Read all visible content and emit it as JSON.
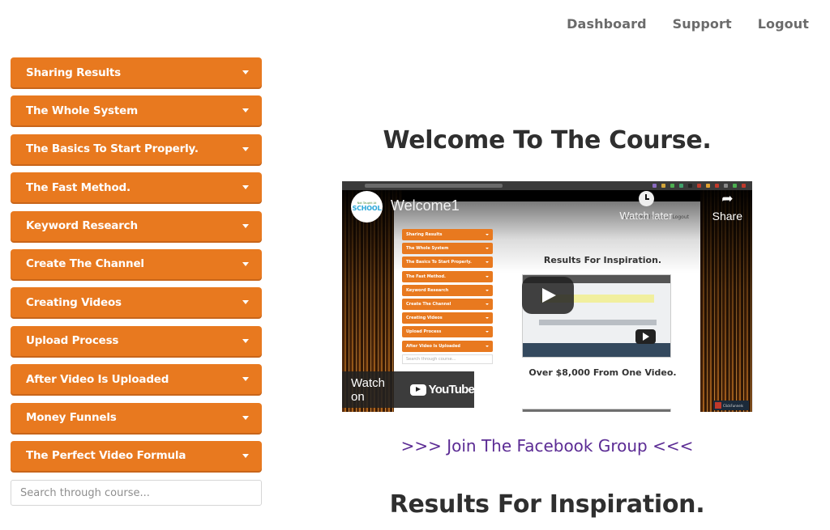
{
  "nav": {
    "links": [
      "Dashboard",
      "Support",
      "Logout"
    ]
  },
  "sidebar": {
    "items": [
      {
        "label": "Sharing Results"
      },
      {
        "label": "The Whole System"
      },
      {
        "label": "The Basics To Start Properly."
      },
      {
        "label": "The Fast Method."
      },
      {
        "label": "Keyword Research"
      },
      {
        "label": "Create The Channel"
      },
      {
        "label": "Creating Videos"
      },
      {
        "label": "Upload Process"
      },
      {
        "label": "After Video Is Uploaded"
      },
      {
        "label": "Money Funnels"
      },
      {
        "label": "The Perfect Video Formula"
      }
    ],
    "search_placeholder": "Search through course..."
  },
  "main": {
    "title": "Welcome To The Course.",
    "facebook_link": ">>> Join The Facebook Group <<<",
    "results_title": "Results For Inspiration."
  },
  "video": {
    "channel_logo_small": "Not Taught At",
    "channel_logo": "SCHOOL",
    "title": "Welcome1",
    "watch_later": "Watch later",
    "share": "Share",
    "watch_on": "Watch on",
    "youtube": "YouTube",
    "inner": {
      "dash_text": "Dashboard   Support   Logout",
      "results_title": "Results For Inspiration.",
      "earnings_title": "Over $8,000 From One Video.",
      "search_placeholder": "Search through course...",
      "menu": [
        "Sharing Results",
        "The Whole System",
        "The Basics To Start Properly.",
        "The Fast Method.",
        "Keyword Research",
        "Create The Channel",
        "Creating Videos",
        "Upload Process",
        "After Video Is Uploaded"
      ]
    },
    "badge": "ClickFunnels"
  },
  "colors": {
    "accent": "#e8791f",
    "link": "#5b2b94",
    "heading": "#2f2f2f",
    "nav": "#6b6b6b"
  }
}
